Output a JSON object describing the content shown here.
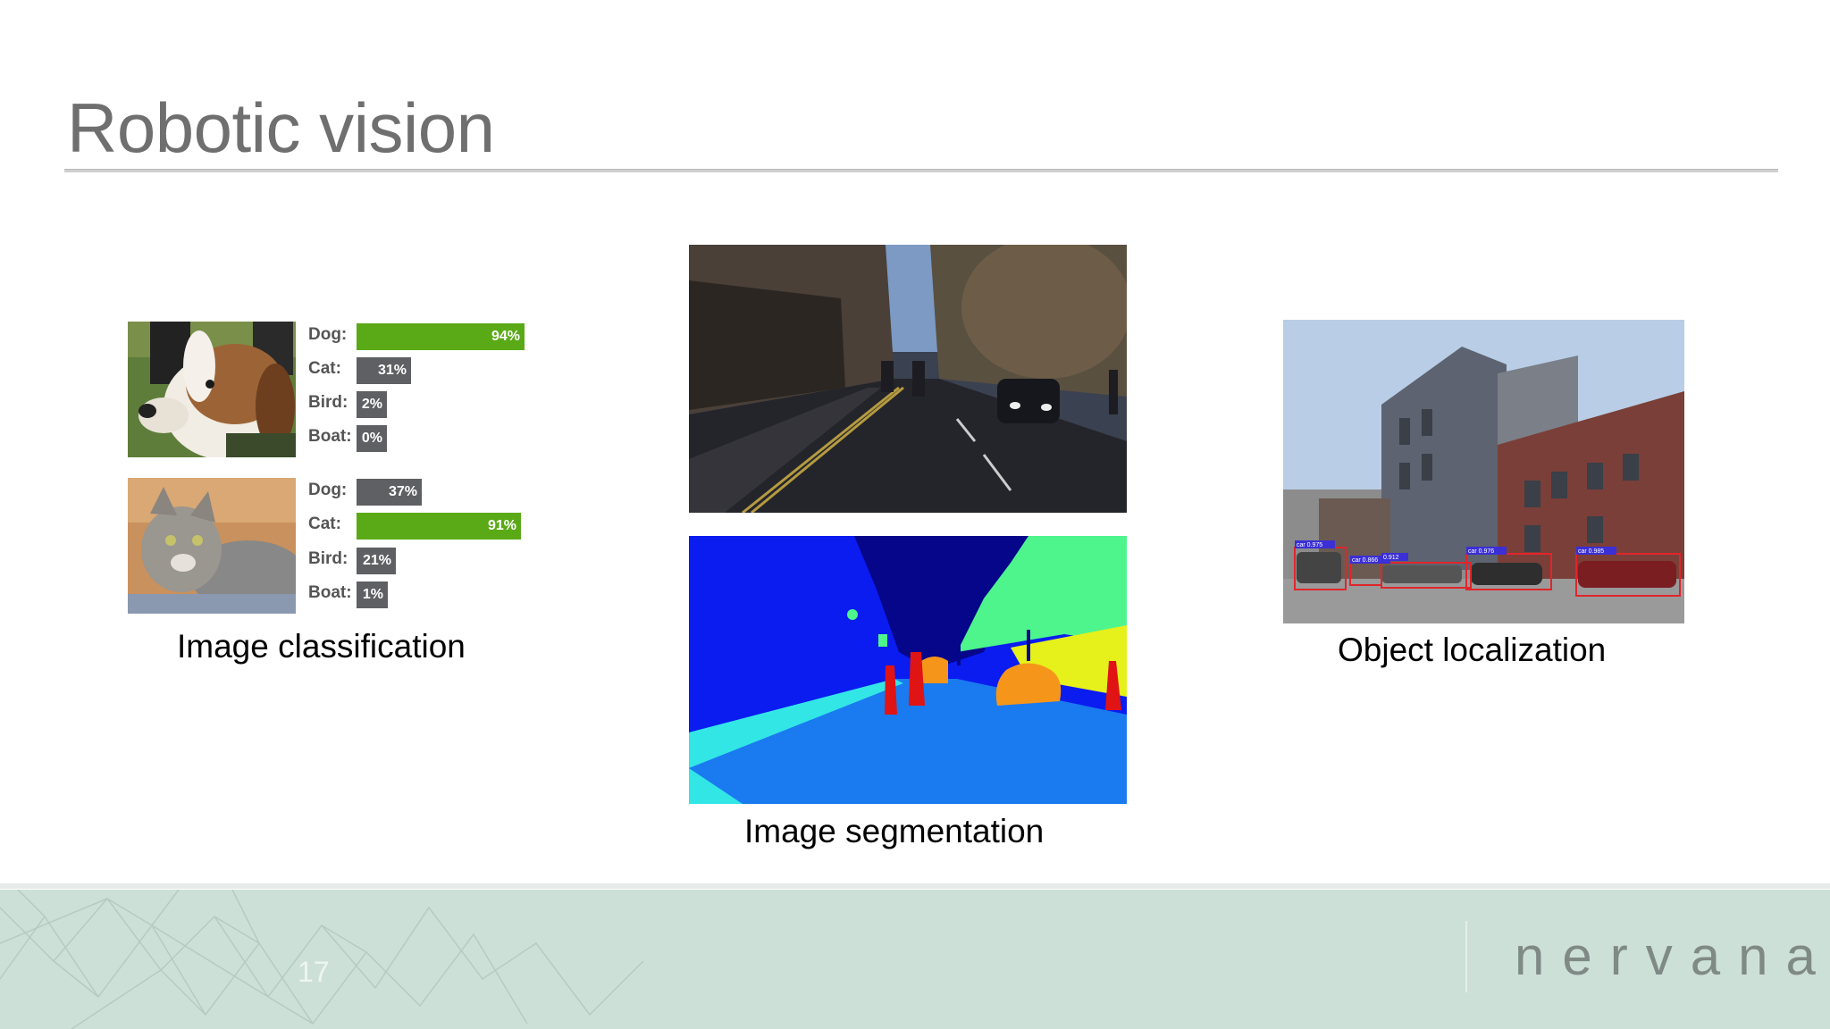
{
  "slide": {
    "title": "Robotic vision",
    "page_number": "17",
    "brand": "nervana"
  },
  "classification": {
    "caption": "Image classification",
    "images": [
      {
        "subject": "dog",
        "scores": [
          {
            "label": "Dog:",
            "value": "94%",
            "fraction": 0.94,
            "top": true
          },
          {
            "label": "Cat:",
            "value": "31%",
            "fraction": 0.31,
            "top": false
          },
          {
            "label": "Bird:",
            "value": "2%",
            "fraction": 0.02,
            "top": false
          },
          {
            "label": "Boat:",
            "value": "0%",
            "fraction": 0.0,
            "top": false
          }
        ]
      },
      {
        "subject": "cat",
        "scores": [
          {
            "label": "Dog:",
            "value": "37%",
            "fraction": 0.37,
            "top": false
          },
          {
            "label": "Cat:",
            "value": "91%",
            "fraction": 0.91,
            "top": true
          },
          {
            "label": "Bird:",
            "value": "21%",
            "fraction": 0.21,
            "top": false
          },
          {
            "label": "Boat:",
            "value": "1%",
            "fraction": 0.01,
            "top": false
          }
        ]
      }
    ],
    "colors": {
      "top_bar": "#5aaa18",
      "other_bar": "#5e6063"
    }
  },
  "segmentation": {
    "caption": "Image segmentation"
  },
  "localization": {
    "caption": "Object localization",
    "detections": [
      {
        "label": "car 0.975"
      },
      {
        "label": "car 0.866"
      },
      {
        "label": "0.912"
      },
      {
        "label": "car 0.976"
      },
      {
        "label": "car 0.985"
      }
    ],
    "box_color": "#e0262b",
    "tag_color": "#3b2fd6"
  },
  "colors": {
    "title": "#6f6f6f",
    "footer_bg": "#cde0d8",
    "seg_sky": "#06068a",
    "seg_building": "#0a1cf0",
    "seg_road": "#1a7af0",
    "seg_sidewalk": "#33e6e6",
    "seg_tree": "#4df58c",
    "seg_car": "#f5961a",
    "seg_person": "#e01414",
    "seg_sign": "#e6f01a"
  }
}
